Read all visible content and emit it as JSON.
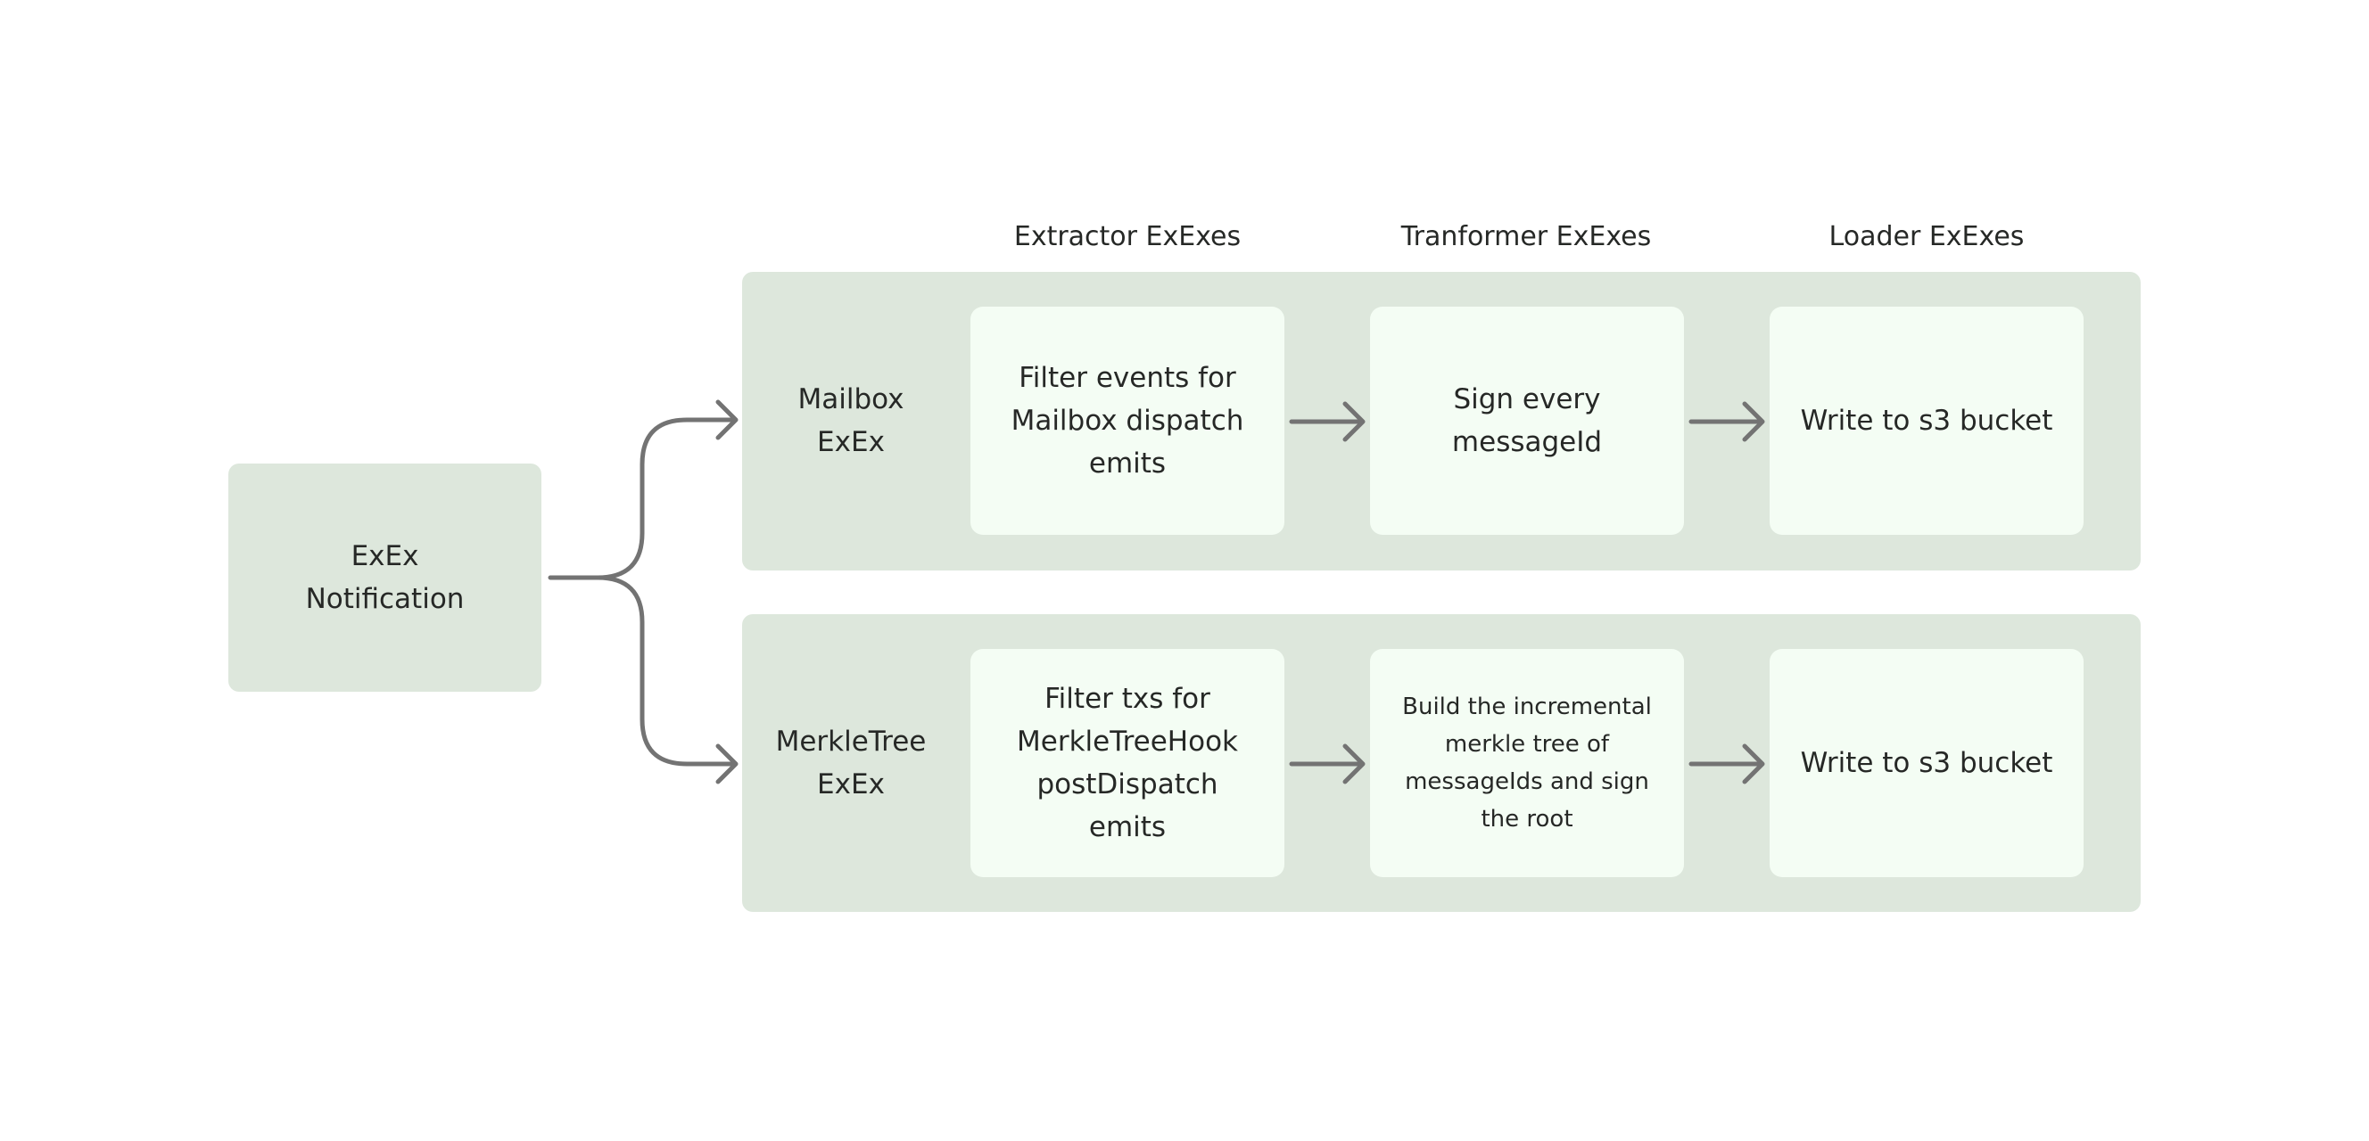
{
  "source": {
    "label": "ExEx\nNotification"
  },
  "columns": [
    "Extractor ExExes",
    "Tranformer ExExes",
    "Loader ExExes"
  ],
  "pipelines": [
    {
      "label": "Mailbox\nExEx",
      "extractor": "Filter events for\nMailbox dispatch\nemits",
      "transformer": "Sign every\nmessageId",
      "loader": "Write to s3 bucket"
    },
    {
      "label": "MerkleTree\nExEx",
      "extractor": "Filter txs for\nMerkleTreeHook\npostDispatch\nemits",
      "transformer": "Build the incremental\nmerkle tree of\nmessageIds and sign\nthe root",
      "loader": "Write to s3 bucket"
    }
  ],
  "colors": {
    "group": "#dde7dc",
    "step": "#f4fdf4",
    "arrow": "#737373",
    "text": "#262826"
  },
  "icons": {
    "connector": "arrow-right-icon",
    "branch": "branch-arrow-icon"
  }
}
